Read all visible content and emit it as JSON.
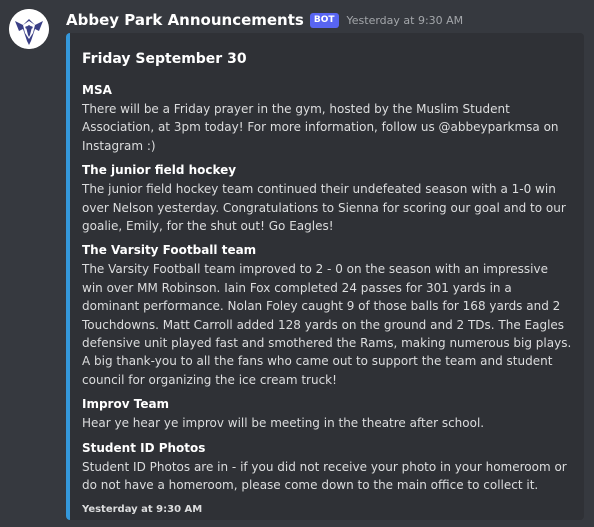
{
  "message": {
    "username": "Abbey Park Announcements",
    "bot_tag": "BOT",
    "timestamp": "Yesterday at 9:30 AM",
    "avatar_icon": "eagle-logo",
    "accent_color": "#3498db"
  },
  "embed": {
    "title": "Friday September 30",
    "fields": [
      {
        "name": "MSA",
        "value": "There will be a Friday prayer in the gym, hosted by the Muslim Student Association, at 3pm today! For more information, follow us @abbeyparkmsa on Instagram :)"
      },
      {
        "name": "The junior field hockey",
        "value": "The junior field hockey team continued their undefeated season with a 1-0 win over Nelson yesterday. Congratulations to Sienna for scoring our goal and to our goalie, Emily, for the shut out! Go Eagles!"
      },
      {
        "name": "The Varsity Football team",
        "value": "The Varsity Football team improved to 2 - 0 on the season with an impressive win over MM Robinson. Iain Fox completed 24 passes for 301 yards in a dominant performance. Nolan Foley caught 9 of those balls for 168 yards and 2 Touchdowns. Matt Carroll added 128 yards on the ground and 2 TDs. The Eagles defensive unit played fast and smothered the Rams, making numerous big plays. A big thank-you to all the fans who came out to support the team and student council for organizing the ice cream truck!"
      },
      {
        "name": "Improv Team",
        "value": "Hear ye hear ye improv will be meeting in the theatre after school."
      },
      {
        "name": "Student ID Photos",
        "value": "Student ID Photos are in - if you did not receive your photo in your homeroom or do not have a homeroom, please come down to the main office to collect it."
      }
    ],
    "footer": "Yesterday at 9:30 AM"
  }
}
